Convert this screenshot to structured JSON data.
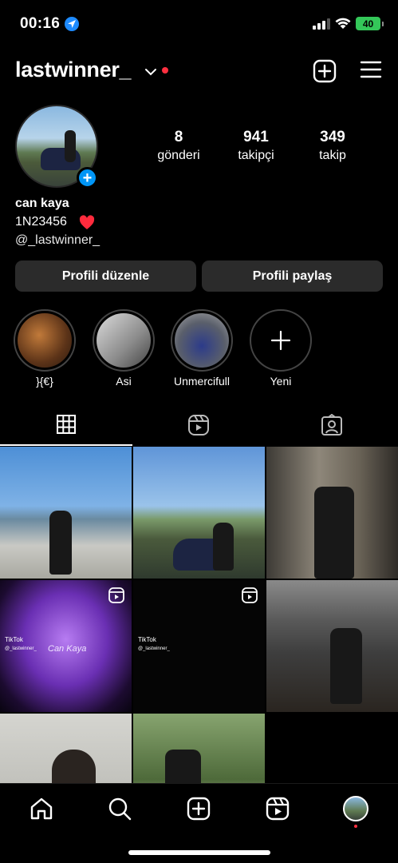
{
  "status": {
    "time": "00:16",
    "battery": "40"
  },
  "header": {
    "username": "lastwinner_"
  },
  "profile": {
    "name": "can kaya",
    "bio": "1N23456",
    "handle": "@_lastwinner_",
    "stats": [
      {
        "value": "8",
        "label": "gönderi"
      },
      {
        "value": "941",
        "label": "takipçi"
      },
      {
        "value": "349",
        "label": "takip"
      }
    ],
    "edit_button": "Profili düzenle",
    "share_button": "Profili paylaş"
  },
  "highlights": [
    {
      "label": "}{€}"
    },
    {
      "label": "Asi"
    },
    {
      "label": "Unmercifull"
    },
    {
      "label": "Yeni"
    }
  ],
  "grid": {
    "tiktok_label": "TikTok",
    "tiktok_handle": "@_lastwinner_",
    "neon_text": "Can Kaya"
  },
  "icons": {
    "accent": "#0095f6",
    "notification": "#ff3040",
    "battery": "#34c759"
  }
}
